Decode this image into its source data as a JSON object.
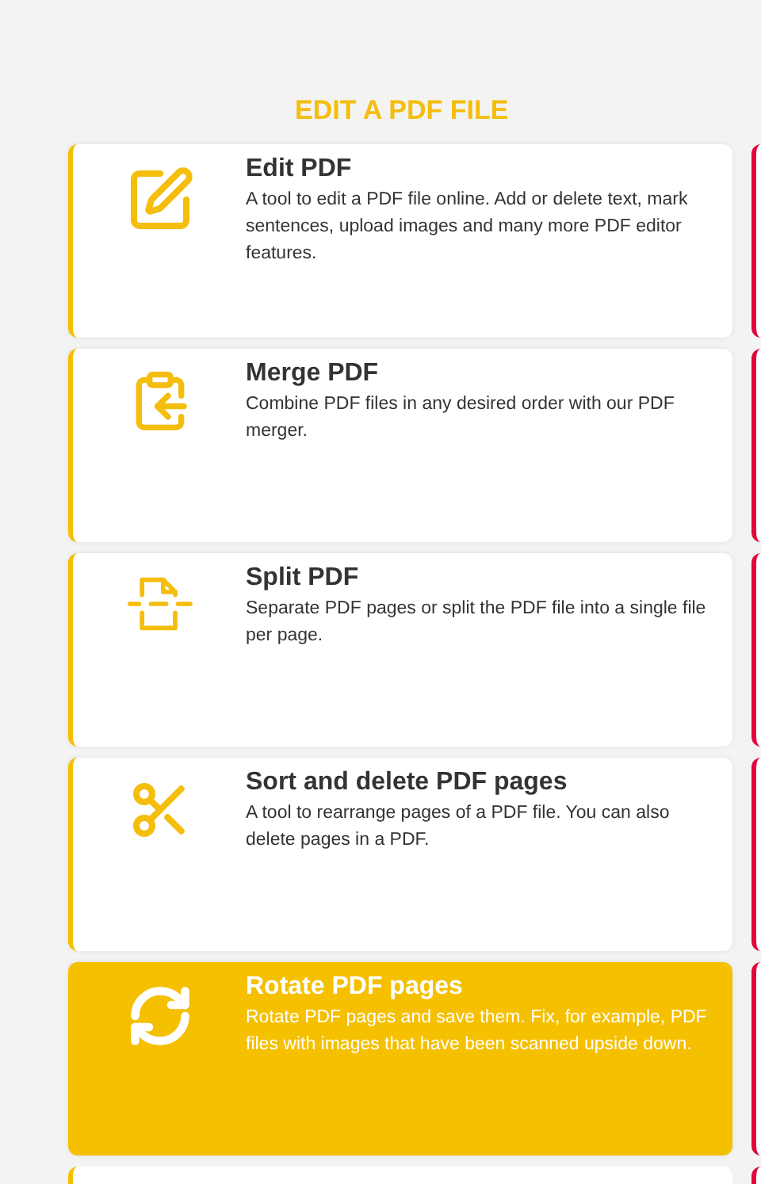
{
  "heading": "EDIT A PDF FILE",
  "tools": [
    {
      "title": "Edit PDF",
      "description": "A tool to edit a PDF file online. Add or delete text, mark sentences, upload images and many more PDF editor features.",
      "selected": false
    },
    {
      "title": "Merge PDF",
      "description": "Combine PDF files in any desired order with our PDF merger.",
      "selected": false
    },
    {
      "title": "Split PDF",
      "description": "Separate PDF pages or split the PDF file into a single file per page.",
      "selected": false
    },
    {
      "title": "Sort and delete PDF pages",
      "description": "A tool to rearrange pages of a PDF file. You can also delete pages in a PDF.",
      "selected": false
    },
    {
      "title": "Rotate PDF pages",
      "description": "Rotate PDF pages and save them. Fix, for example, PDF files with images that have been scanned upside down.",
      "selected": true
    }
  ]
}
